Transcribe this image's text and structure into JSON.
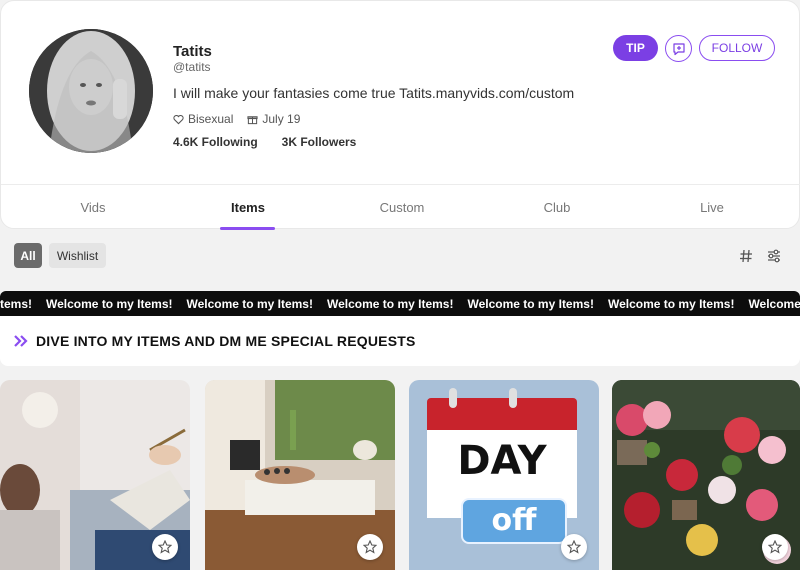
{
  "profile": {
    "name": "Tatits",
    "handle": "@tatits",
    "bio": "I will make your fantasies come true Tatits.manyvids.com/custom",
    "orientation": "Bisexual",
    "birthday": "July 19",
    "following": "4.6K Following",
    "followers": "3K Followers"
  },
  "actions": {
    "tip_label": "TIP",
    "follow_label": "FOLLOW",
    "message_icon": "message-plus-icon"
  },
  "tabs": [
    {
      "label": "Vids",
      "active": false
    },
    {
      "label": "Items",
      "active": true
    },
    {
      "label": "Custom",
      "active": false
    },
    {
      "label": "Club",
      "active": false
    },
    {
      "label": "Live",
      "active": false
    }
  ],
  "filters": {
    "all_label": "All",
    "wishlist_label": "Wishlist",
    "icons": [
      "hash-icon",
      "sliders-icon"
    ]
  },
  "banner": {
    "marquee_text": "Welcome to my Items!",
    "marquee_prefix": "tems!",
    "section_title": "DIVE INTO MY ITEMS AND DM ME SPECIAL REQUESTS"
  },
  "items": [
    {
      "image": "therapy-session-photo"
    },
    {
      "image": "spa-hot-stone-massage-photo"
    },
    {
      "image": "day-off-calendar",
      "calendar_day": "DAY",
      "calendar_off": "off"
    },
    {
      "image": "flower-shop-photo"
    }
  ],
  "colors": {
    "accent": "#7b3fe4",
    "banner_bg": "#0d0d0d",
    "page_bg": "#f2f2f2"
  }
}
